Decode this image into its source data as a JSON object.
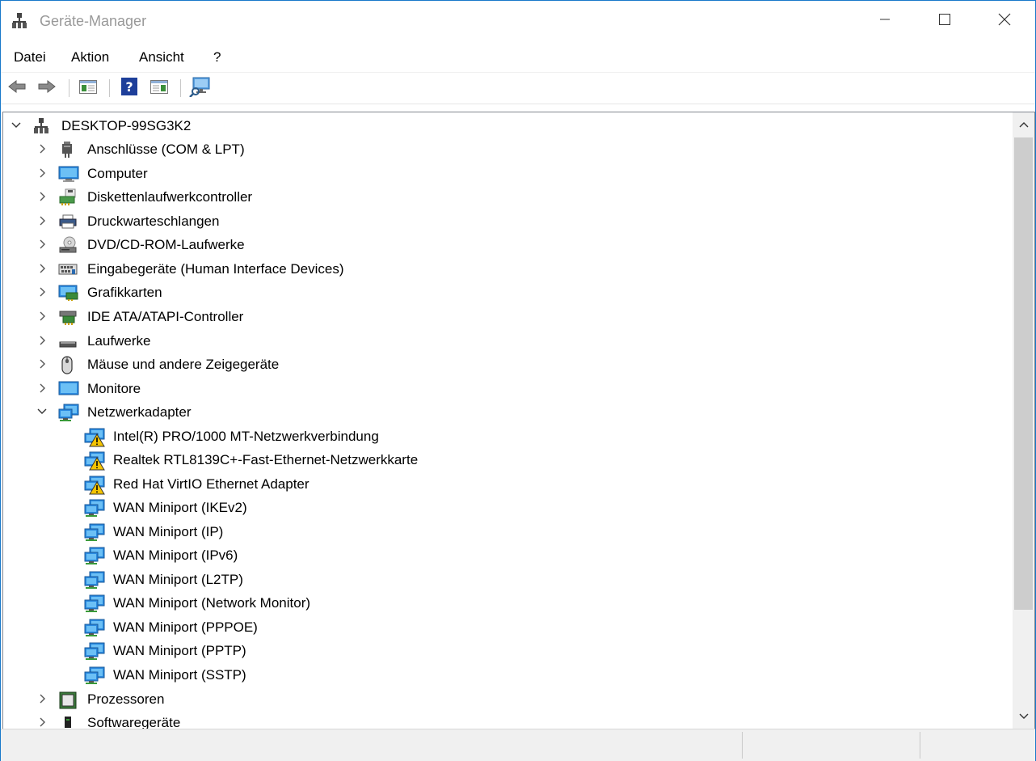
{
  "window": {
    "title": "Geräte-Manager",
    "accent_color": "#1979ca",
    "icons": {
      "app": "device-manager-icon",
      "minimize": "minimize-icon",
      "maximize": "maximize-icon",
      "close": "close-icon"
    }
  },
  "menu": {
    "items": [
      {
        "label": "Datei"
      },
      {
        "label": "Aktion"
      },
      {
        "label": "Ansicht"
      },
      {
        "label": "?"
      }
    ]
  },
  "toolbar": {
    "buttons": [
      {
        "icon": "back-arrow-icon",
        "enabled": true
      },
      {
        "icon": "forward-arrow-icon",
        "enabled": true
      },
      {
        "icon": "show-hide-console-tree-icon",
        "enabled": true
      },
      {
        "icon": "help-icon",
        "enabled": true
      },
      {
        "icon": "show-hide-action-pane-icon",
        "enabled": true
      },
      {
        "icon": "scan-hardware-changes-icon",
        "enabled": true
      }
    ]
  },
  "tree": {
    "root": {
      "label": "DESKTOP-99SG3K2",
      "icon": "computer-root-icon",
      "expanded": true
    },
    "categories": [
      {
        "label": "Anschlüsse (COM & LPT)",
        "icon": "port-icon",
        "expanded": false
      },
      {
        "label": "Computer",
        "icon": "computer-icon",
        "expanded": false
      },
      {
        "label": "Diskettenlaufwerkcontroller",
        "icon": "floppy-controller-icon",
        "expanded": false
      },
      {
        "label": "Druckwarteschlangen",
        "icon": "printer-icon",
        "expanded": false
      },
      {
        "label": "DVD/CD-ROM-Laufwerke",
        "icon": "dvd-drive-icon",
        "expanded": false
      },
      {
        "label": "Eingabegeräte (Human Interface Devices)",
        "icon": "hid-icon",
        "expanded": false
      },
      {
        "label": "Grafikkarten",
        "icon": "display-adapter-icon",
        "expanded": false
      },
      {
        "label": "IDE ATA/ATAPI-Controller",
        "icon": "ide-controller-icon",
        "expanded": false
      },
      {
        "label": "Laufwerke",
        "icon": "disk-drive-icon",
        "expanded": false
      },
      {
        "label": "Mäuse und andere Zeigegeräte",
        "icon": "mouse-icon",
        "expanded": false
      },
      {
        "label": "Monitore",
        "icon": "monitor-icon",
        "expanded": false
      },
      {
        "label": "Netzwerkadapter",
        "icon": "network-adapter-icon",
        "expanded": true,
        "children": [
          {
            "label": "Intel(R) PRO/1000 MT-Netzwerkverbindung",
            "icon": "network-adapter-warning-icon",
            "warning": true
          },
          {
            "label": "Realtek RTL8139C+-Fast-Ethernet-Netzwerkkarte",
            "icon": "network-adapter-warning-icon",
            "warning": true
          },
          {
            "label": "Red Hat VirtIO Ethernet Adapter",
            "icon": "network-adapter-warning-icon",
            "warning": true
          },
          {
            "label": "WAN Miniport (IKEv2)",
            "icon": "network-adapter-icon",
            "warning": false
          },
          {
            "label": "WAN Miniport (IP)",
            "icon": "network-adapter-icon",
            "warning": false
          },
          {
            "label": "WAN Miniport (IPv6)",
            "icon": "network-adapter-icon",
            "warning": false
          },
          {
            "label": "WAN Miniport (L2TP)",
            "icon": "network-adapter-icon",
            "warning": false
          },
          {
            "label": "WAN Miniport (Network Monitor)",
            "icon": "network-adapter-icon",
            "warning": false
          },
          {
            "label": "WAN Miniport (PPPOE)",
            "icon": "network-adapter-icon",
            "warning": false
          },
          {
            "label": "WAN Miniport (PPTP)",
            "icon": "network-adapter-icon",
            "warning": false
          },
          {
            "label": "WAN Miniport (SSTP)",
            "icon": "network-adapter-icon",
            "warning": false
          }
        ]
      },
      {
        "label": "Prozessoren",
        "icon": "processor-icon",
        "expanded": false
      },
      {
        "label": "Softwaregeräte",
        "icon": "software-device-icon",
        "expanded": false
      }
    ]
  },
  "status": {
    "panes": [
      "",
      "",
      ""
    ]
  }
}
